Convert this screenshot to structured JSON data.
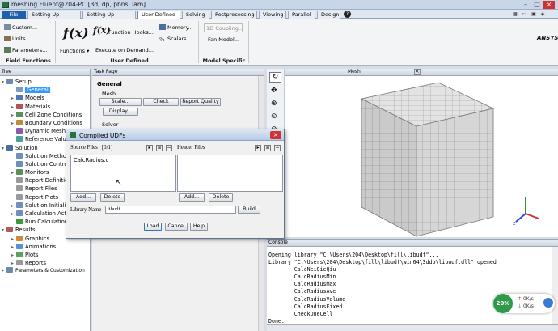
{
  "window": {
    "title": "meshing Fluent@204-PC [3d, dp, pbns, lam]",
    "brand": "ANSYS"
  },
  "ribbon_tabs": [
    {
      "label": "File"
    },
    {
      "label": "Setting Up Domain"
    },
    {
      "label": "Setting Up Physics"
    },
    {
      "label": "User-Defined"
    },
    {
      "label": "Solving"
    },
    {
      "label": "Postprocessing"
    },
    {
      "label": "Viewing"
    },
    {
      "label": "Parallel"
    },
    {
      "label": "Design"
    }
  ],
  "ribbon": {
    "field_functions": {
      "custom": "Custom...",
      "units": "Units...",
      "parameters": "Parameters...",
      "label": "Field Functions"
    },
    "user_defined": {
      "fx1": "f(x)",
      "functions": "Functions",
      "fx2": "f(x)",
      "function_hooks": "Function Hooks...",
      "execute_on_demand": "Execute on Demand...",
      "memory": "Memory...",
      "scalars": "Scalars...",
      "label": "User Defined"
    },
    "model_specific": {
      "one_d_coupling": "1D Coupling...",
      "fan_model": "Fan Model...",
      "label": "Model Specific"
    }
  },
  "tree": {
    "header": "Tree",
    "items": [
      {
        "label": "Setup"
      },
      {
        "label": "General"
      },
      {
        "label": "Models"
      },
      {
        "label": "Materials"
      },
      {
        "label": "Cell Zone Conditions"
      },
      {
        "label": "Boundary Conditions"
      },
      {
        "label": "Dynamic Mesh"
      },
      {
        "label": "Reference Values"
      },
      {
        "label": "Solution"
      },
      {
        "label": "Solution Methods"
      },
      {
        "label": "Solution Controls"
      },
      {
        "label": "Monitors"
      },
      {
        "label": "Report Definitions"
      },
      {
        "label": "Report Files"
      },
      {
        "label": "Report Plots"
      },
      {
        "label": "Solution Initialization"
      },
      {
        "label": "Calculation Activities"
      },
      {
        "label": "Run Calculation"
      },
      {
        "label": "Results"
      },
      {
        "label": "Graphics"
      },
      {
        "label": "Animations"
      },
      {
        "label": "Plots"
      },
      {
        "label": "Reports"
      },
      {
        "label": "Parameters & Customization"
      }
    ]
  },
  "task_page": {
    "header": "Task Page",
    "general": "General",
    "mesh": "Mesh",
    "scale": "Scale...",
    "check": "Check",
    "report_quality": "Report Quality",
    "display": "Display...",
    "solver": "Solver"
  },
  "mesh_view": {
    "tab": "Mesh"
  },
  "dialog": {
    "title": "Compiled UDFs",
    "source_files_label": "Source Files",
    "source_count": "[0/1]",
    "header_files_label": "Header Files",
    "source_files": [
      "CalcRadius.c"
    ],
    "add": "Add...",
    "delete": "Delete",
    "add2": "Add...",
    "delete2": "Delete",
    "library_name_label": "Library Name",
    "library_name": "libudf",
    "build": "Build",
    "load": "Load",
    "cancel": "Cancel",
    "help": "Help"
  },
  "console": {
    "header": "Console",
    "lines": [
      "Opening library \"C:\\Users\\204\\Desktop\\fill\\libudf\"...",
      "Library \"C:\\Users\\204\\Desktop\\fill\\libudf\\win64\\3ddp\\libudf.dll\" opened",
      "        CalcNeiQieQiu",
      "        CalcRadiusMin",
      "        CalcRadiusMax",
      "        CalcRadiusAve",
      "        CalcRadiusVolume",
      "        CalcRadiusFixed",
      "        CheckOneCell",
      "Done."
    ]
  },
  "net_widget": {
    "percent": "20%",
    "up": "0K/s",
    "down": "0K/s"
  },
  "colors": {
    "accent": "#1f5fae",
    "selection": "#3399ff",
    "cube": "#d9d9d9"
  }
}
